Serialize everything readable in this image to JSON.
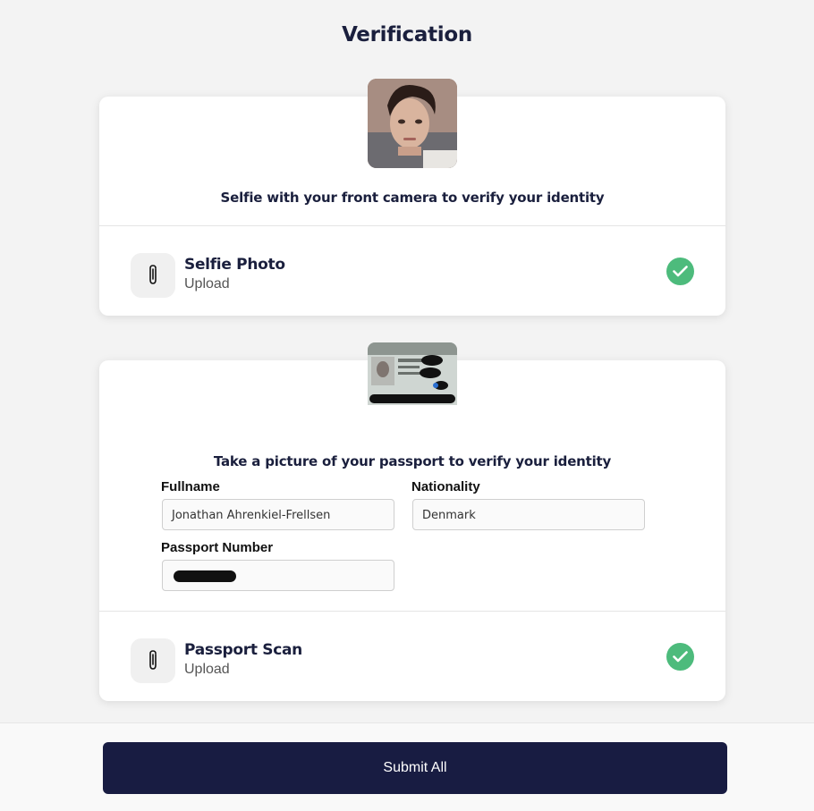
{
  "page": {
    "title": "Verification"
  },
  "selfie": {
    "description": "Selfie with your front camera to verify your identity",
    "upload_title": "Selfie Photo",
    "upload_sub": "Upload",
    "status": "complete"
  },
  "passport": {
    "description": "Take a picture of your passport to verify your identity",
    "fields": {
      "fullname_label": "Fullname",
      "fullname_value": "Jonathan Ahrenkiel-Frellsen",
      "nationality_label": "Nationality",
      "nationality_value": "Denmark",
      "passport_number_label": "Passport Number"
    },
    "upload_title": "Passport Scan",
    "upload_sub": "Upload",
    "status": "complete"
  },
  "footer": {
    "submit_label": "Submit All"
  },
  "colors": {
    "primary": "#181c42",
    "success": "#4dbb7c",
    "heading": "#1a1f3d"
  },
  "icons": {
    "attach": "paperclip-icon",
    "done": "check-circle-icon"
  }
}
